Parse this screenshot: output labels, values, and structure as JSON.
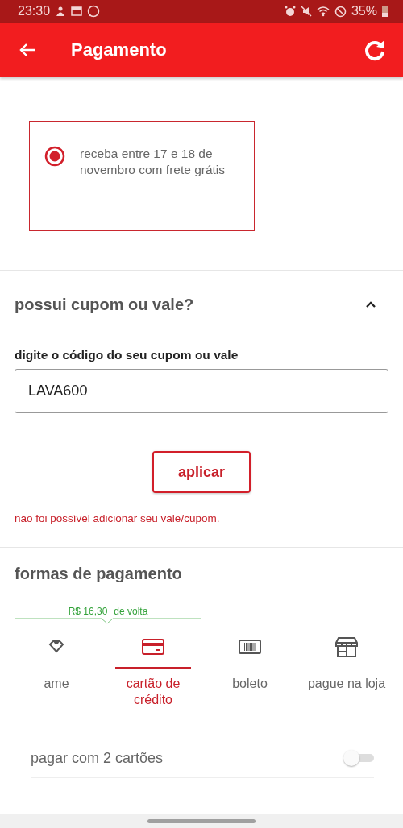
{
  "status_bar": {
    "time": "23:30",
    "battery": "35%"
  },
  "app_bar": {
    "title": "Pagamento"
  },
  "delivery_options": [
    {
      "text": "receba entre 17 e 18 de novembro com frete grátis",
      "selected": true
    }
  ],
  "coupon": {
    "title": "possui cupom ou vale?",
    "expanded": true,
    "label": "digite o código do seu cupom ou vale",
    "value": "LAVA600",
    "button": "aplicar",
    "error": "não foi possível adicionar seu vale/cupom."
  },
  "payment": {
    "title": "formas de pagamento",
    "cashback": {
      "amount": "R$ 16,30",
      "suffix": "de volta"
    },
    "methods": [
      {
        "kind": "diamond",
        "label": "ame",
        "selected": false
      },
      {
        "kind": "card",
        "label": "cartão de crédito",
        "selected": true
      },
      {
        "kind": "barcode",
        "label": "boleto",
        "selected": false
      },
      {
        "kind": "store",
        "label": "pague na loja",
        "selected": false
      }
    ],
    "two_cards": {
      "label": "pagar com 2 cartões",
      "on": false
    }
  }
}
